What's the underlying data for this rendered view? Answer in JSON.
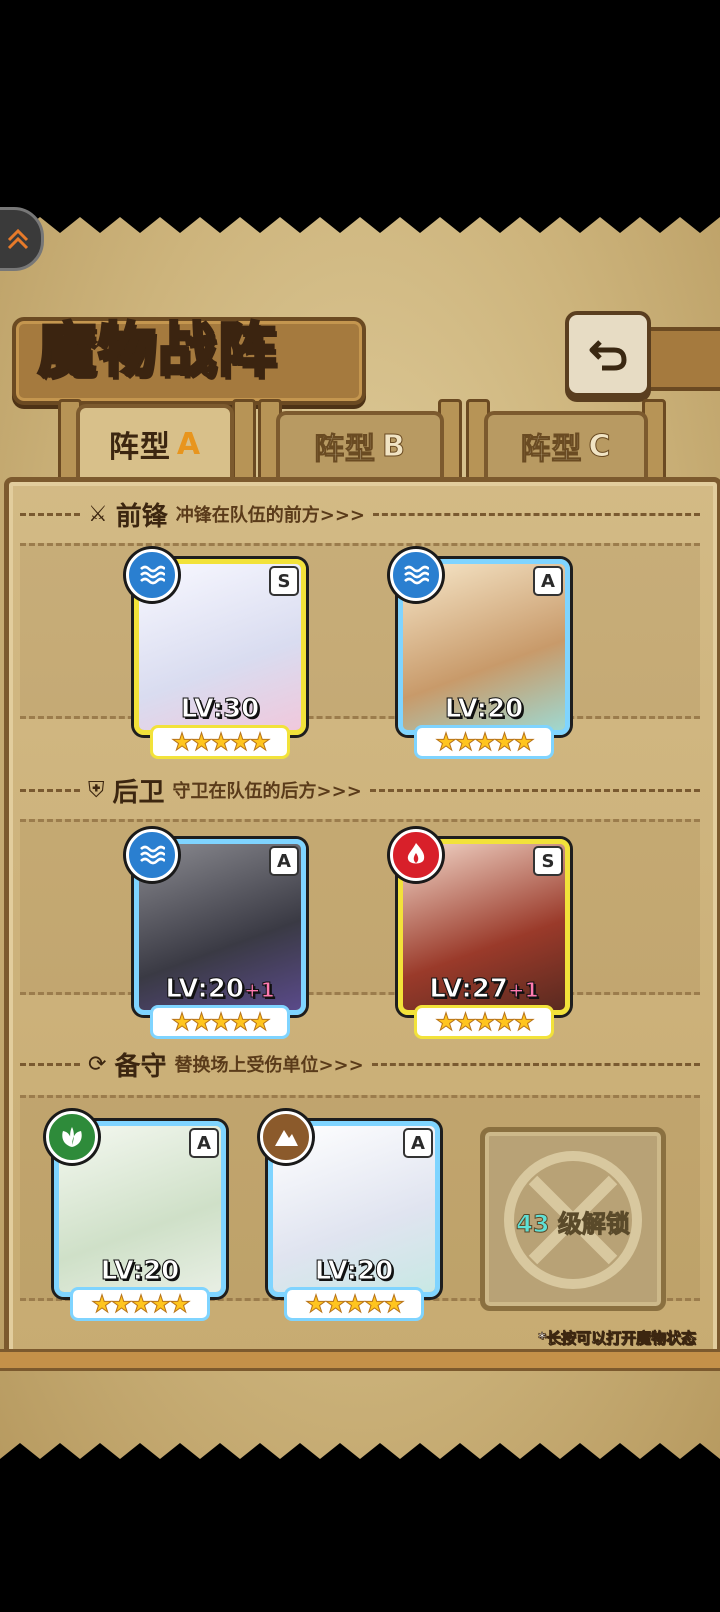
{
  "title": "魔物战阵",
  "tabs": [
    {
      "label": "阵型",
      "letter": "A",
      "active": true
    },
    {
      "label": "阵型",
      "letter": "B",
      "active": false
    },
    {
      "label": "阵型",
      "letter": "C",
      "active": false
    }
  ],
  "sections": {
    "front": {
      "title": "前锋",
      "subtitle": "冲锋在队伍的前方>>>",
      "icon": "sword-icon"
    },
    "rear": {
      "title": "后卫",
      "subtitle": "守卫在队伍的后方>>>",
      "icon": "shield-icon"
    },
    "reserve": {
      "title": "备守",
      "subtitle": "替换场上受伤单位>>>",
      "icon": "swap-icon"
    }
  },
  "cards": [
    {
      "rank": "S",
      "element": "water",
      "level": "LV:30",
      "bonus": "",
      "stars": "★★★★★"
    },
    {
      "rank": "A",
      "element": "water",
      "level": "LV:20",
      "bonus": "",
      "stars": "★★★★★"
    },
    {
      "rank": "A",
      "element": "water",
      "level": "LV:20",
      "bonus": "+1",
      "stars": "★★★★★"
    },
    {
      "rank": "S",
      "element": "fire",
      "level": "LV:27",
      "bonus": "+1",
      "stars": "★★★★★"
    },
    {
      "rank": "A",
      "element": "nature",
      "level": "LV:20",
      "bonus": "",
      "stars": "★★★★★"
    },
    {
      "rank": "A",
      "element": "earth",
      "level": "LV:20",
      "bonus": "",
      "stars": "★★★★★"
    }
  ],
  "locked_slot": {
    "level": "43",
    "text": "级解锁"
  },
  "hint": "*长按可以打开魔物状态",
  "colors": {
    "water": "#2a7fd0",
    "fire": "#d8202a",
    "nature": "#2e8b3a",
    "earth": "#8b5a2b",
    "frame_s": "#f2e23a",
    "frame_a": "#7fd4ff"
  }
}
